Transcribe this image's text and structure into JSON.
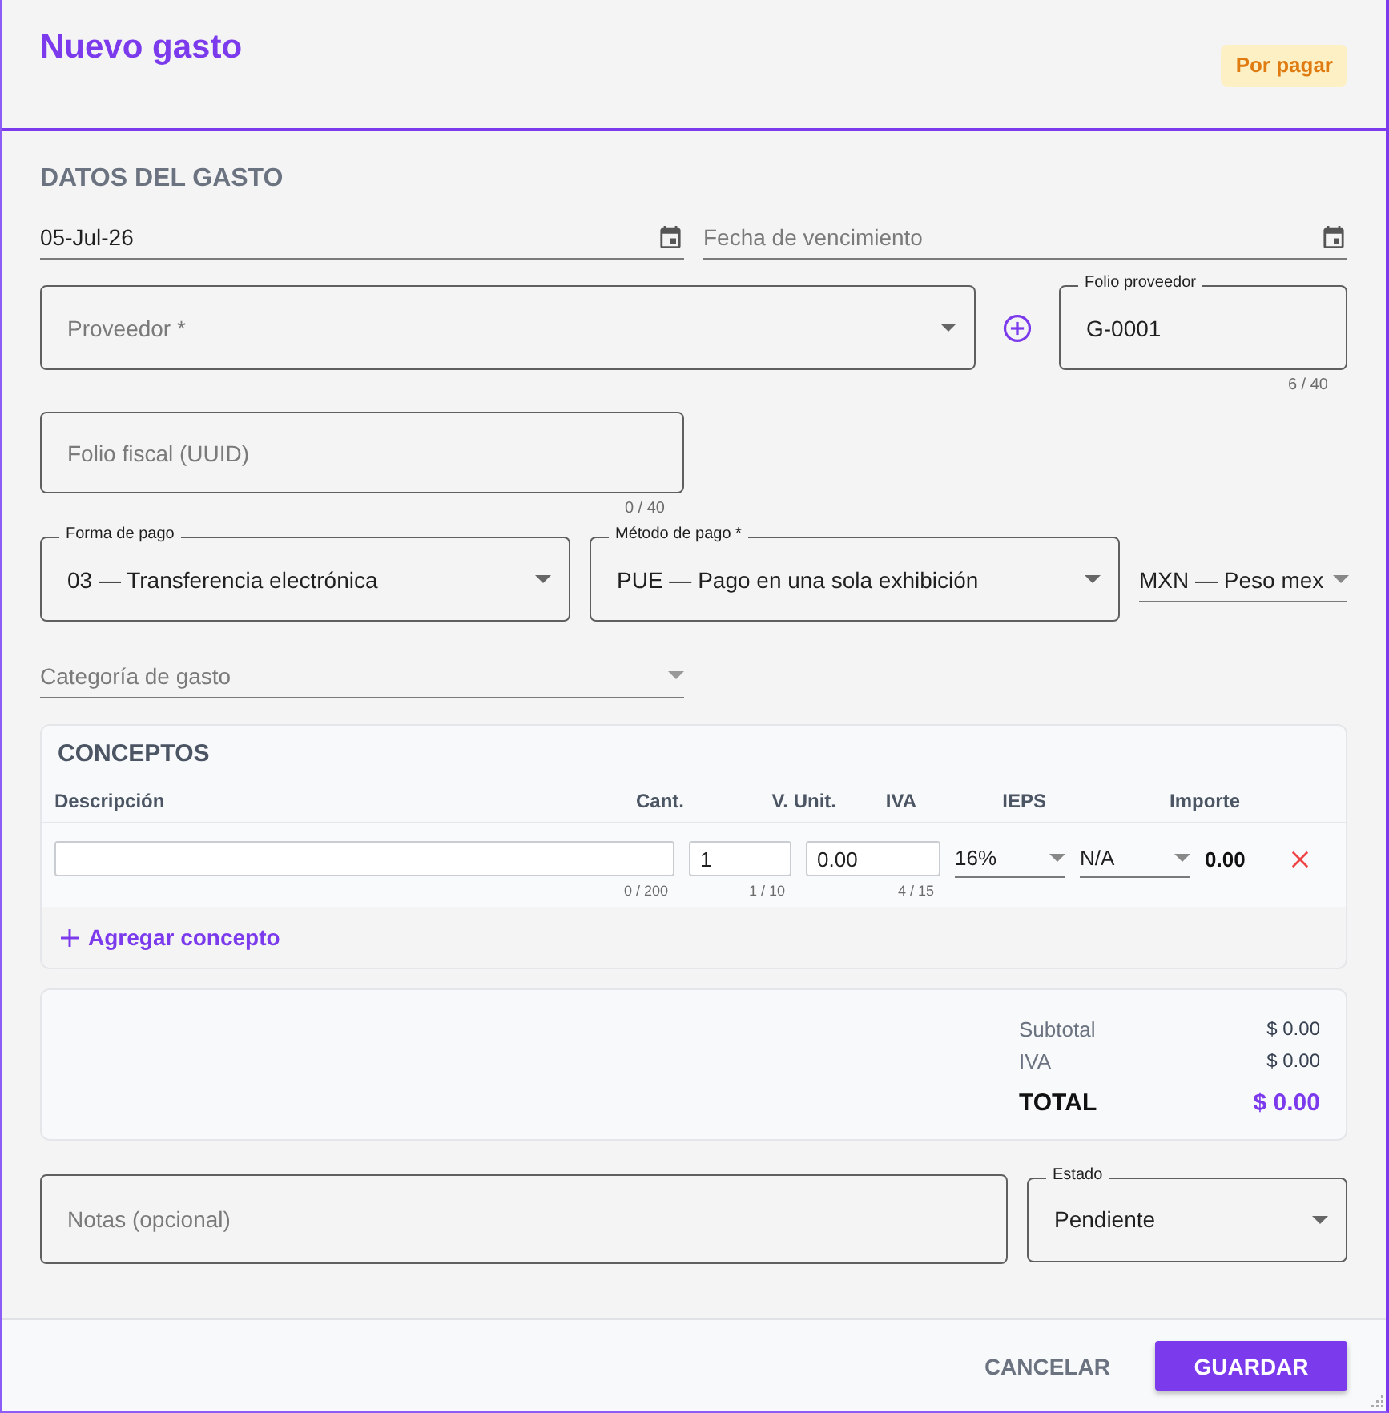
{
  "header": {
    "title": "Nuevo gasto",
    "badge": "Por pagar"
  },
  "section_title": "DATOS DEL GASTO",
  "fecha": {
    "value": "05-Jul-26"
  },
  "vencimiento": {
    "placeholder": "Fecha de vencimiento"
  },
  "proveedor": {
    "placeholder": "Proveedor *"
  },
  "folio_proveedor": {
    "label": "Folio proveedor",
    "value": "G-0001",
    "counter": "6 / 40"
  },
  "folio_fiscal": {
    "placeholder": "Folio fiscal (UUID)",
    "counter": "0 / 40"
  },
  "forma_pago": {
    "label": "Forma de pago",
    "value": "03 — Transferencia electrónica"
  },
  "metodo_pago": {
    "label": "Método de pago *",
    "value": "PUE — Pago en una sola exhibición"
  },
  "moneda": {
    "value": "MXN — Peso mex"
  },
  "categoria": {
    "placeholder": "Categoría de gasto"
  },
  "conceptos": {
    "title": "CONCEPTOS",
    "columns": [
      "Descripción",
      "Cant.",
      "V. Unit.",
      "IVA",
      "IEPS",
      "Importe"
    ],
    "rows": [
      {
        "descripcion_counter": "0 / 200",
        "cantidad": "1",
        "cantidad_counter": "1 / 10",
        "valor_unitario": "0.00",
        "valor_unitario_counter": "4 / 15",
        "iva": "16%",
        "ieps": "N/A",
        "importe": "0.00"
      }
    ],
    "add_label": "Agregar concepto"
  },
  "totals": [
    {
      "kind": "line",
      "label": "Subtotal",
      "value": "$ 0.00"
    },
    {
      "kind": "line",
      "label": "IVA",
      "value": "$ 0.00"
    },
    {
      "kind": "total",
      "label": "TOTAL",
      "value": "$ 0.00"
    }
  ],
  "notas": {
    "placeholder": "Notas (opcional)"
  },
  "estado": {
    "label": "Estado",
    "value": "Pendiente"
  },
  "buttons": [
    {
      "kind": "text",
      "label": "CANCELAR"
    },
    {
      "kind": "primary",
      "label": "GUARDAR"
    }
  ]
}
